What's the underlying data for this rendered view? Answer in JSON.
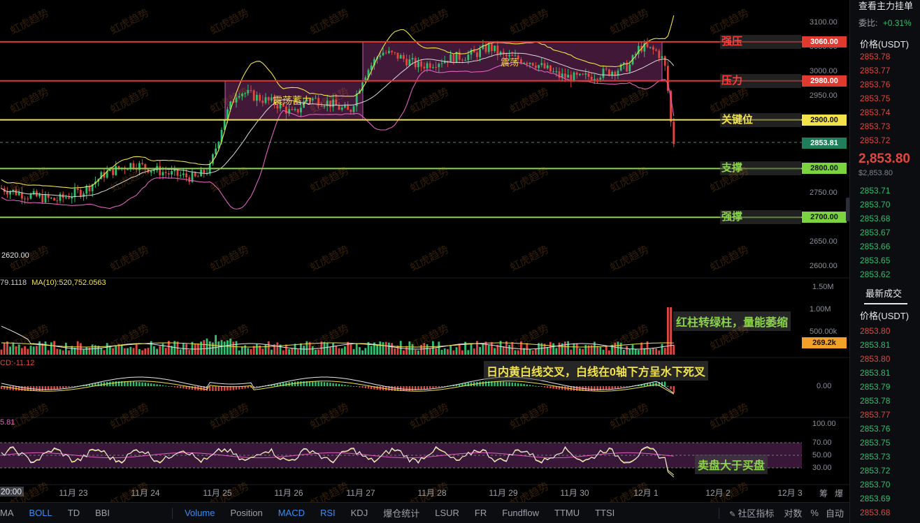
{
  "colors": {
    "red_line": "#e0392f",
    "yellow_line": "#f2e34a",
    "green_line": "#8bd44a",
    "up": "#2fbf71",
    "down": "#e0473f",
    "box_fill": "rgba(190,70,160,0.35)",
    "boll_upper": "#f2e34a",
    "boll_mid": "#d9d9d9",
    "boll_lower": "#e060c0",
    "current_price": "#2a9d6f",
    "volume_tag": "#f0a12a"
  },
  "price_axis": {
    "ticks": [
      "3100.00",
      "3050.00",
      "3000.00",
      "2950.00",
      "2900.00",
      "2850.00",
      "2800.00",
      "2750.00",
      "2700.00",
      "2650.00",
      "2600.00"
    ],
    "min_label": "2620.00"
  },
  "levels": [
    {
      "name": "强压",
      "value": "3060.00",
      "color": "red"
    },
    {
      "name": "压力",
      "value": "2980.00",
      "color": "red"
    },
    {
      "name": "关键位",
      "value": "2900.00",
      "color": "yellow"
    },
    {
      "name": "支撑",
      "value": "2800.00",
      "color": "green"
    },
    {
      "name": "强撑",
      "value": "2700.00",
      "color": "green"
    }
  ],
  "current_price_tag": "2853.81",
  "boxes": [
    {
      "label": "震荡蓄力"
    },
    {
      "label": "震荡"
    }
  ],
  "volume_panel": {
    "ma_text_1": "79.1118",
    "ma_text_2": "MA(10):520,752.0563",
    "ticks": [
      "1.50M",
      "1.00M",
      "500.00k"
    ],
    "current": "269.2k",
    "annotation": "红柱转绿柱，量能萎缩"
  },
  "macd_panel": {
    "label": "CD:-11.12",
    "tick": "0.00",
    "annotation": "日内黄白线交叉，白线在0轴下方呈水下死叉"
  },
  "rsi_panel": {
    "label": "5.81",
    "ticks": [
      "100.00",
      "70.00",
      "50.00",
      "30.00"
    ],
    "annotation": "卖盘大于买盘"
  },
  "dates": [
    "20:00",
    "11月 23",
    "11月 24",
    "11月 25",
    "11月 26",
    "11月 27",
    "11月 28",
    "11月 29",
    "11月 30",
    "12月 1",
    "12月 2",
    "12月 3"
  ],
  "chart_data": {
    "type": "candlestick",
    "symbol_quote": "USDT",
    "price_range": [
      2600,
      3120
    ],
    "key_levels": [
      3060,
      2980,
      2900,
      2800,
      2700
    ],
    "last_price": 2853.81,
    "consolidation_boxes": [
      {
        "label": "震荡蓄力",
        "high": 2980,
        "low": 2900,
        "from": "11月 25",
        "to": "11月 27"
      },
      {
        "label": "震荡",
        "high": 3060,
        "low": 2980,
        "from": "11月 27",
        "to": "12月 1"
      }
    ],
    "volume_last": "269.2k",
    "macd_value": -11.12,
    "rsi_levels": [
      70,
      50,
      30
    ]
  },
  "bottom_bar": {
    "left_tabs": [
      "MA",
      "BOLL",
      "TD",
      "BBI"
    ],
    "active_left": "BOLL",
    "sub_tabs": [
      "Volume",
      "Position",
      "MACD",
      "RSI",
      "KDJ",
      "爆仓统计",
      "LSUR",
      "FR",
      "Fundflow",
      "TTMU",
      "TTSI"
    ],
    "active_sub": [
      "Volume",
      "MACD",
      "RSI"
    ],
    "right_items": [
      "社区指标",
      "对数",
      "%",
      "自动"
    ],
    "corner_items": [
      "筹",
      "爆"
    ]
  },
  "side_panel": {
    "header": "查看主力挂单",
    "ratio_label": "委比:",
    "ratio_value": "+0.31%",
    "price_header": "价格(USDT)",
    "asks": [
      "2853.78",
      "2853.77",
      "2853.76",
      "2853.75",
      "2853.74",
      "2853.73",
      "2853.72"
    ],
    "last_price": "2,853.80",
    "last_price_sub": "$2,853.80",
    "bids": [
      "2853.71",
      "2853.70",
      "2853.68",
      "2853.67",
      "2853.66",
      "2853.65",
      "2853.62"
    ],
    "trades_header": "最新成交",
    "trades_price_header": "价格(USDT)",
    "trades": [
      {
        "price": "2853.80",
        "side": "sell"
      },
      {
        "price": "2853.81",
        "side": "buy"
      },
      {
        "price": "2853.80",
        "side": "sell"
      },
      {
        "price": "2853.81",
        "side": "buy"
      },
      {
        "price": "2853.79",
        "side": "buy"
      },
      {
        "price": "2853.78",
        "side": "buy"
      },
      {
        "price": "2853.77",
        "side": "sell"
      },
      {
        "price": "2853.76",
        "side": "buy"
      },
      {
        "price": "2853.75",
        "side": "buy"
      },
      {
        "price": "2853.73",
        "side": "buy"
      },
      {
        "price": "2853.72",
        "side": "buy"
      },
      {
        "price": "2853.70",
        "side": "buy"
      },
      {
        "price": "2853.69",
        "side": "buy"
      },
      {
        "price": "2853.68",
        "side": "sell"
      }
    ]
  },
  "watermark_text": "虹虎趋势"
}
